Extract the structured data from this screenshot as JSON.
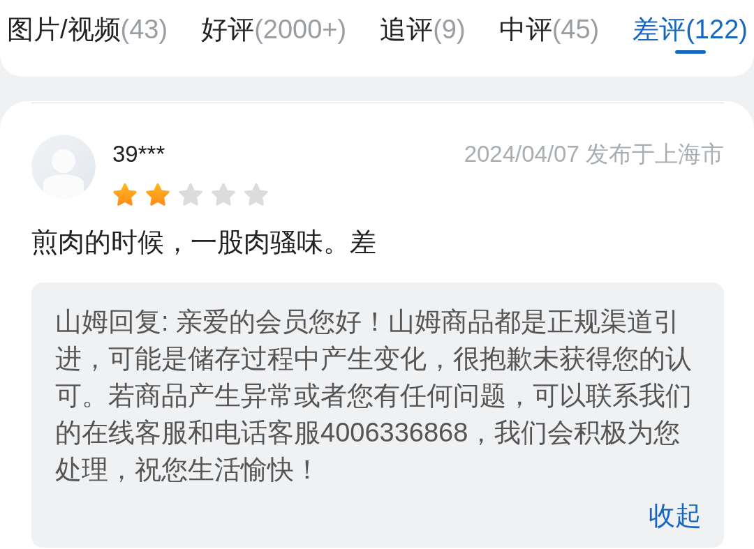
{
  "tabs": [
    {
      "label": "图片/视频",
      "count": "(43)",
      "selected": false
    },
    {
      "label": "好评",
      "count": "(2000+)",
      "selected": false
    },
    {
      "label": "追评",
      "count": "(9)",
      "selected": false
    },
    {
      "label": "中评",
      "count": "(45)",
      "selected": false
    },
    {
      "label": "差评",
      "count": "(122)",
      "selected": true
    }
  ],
  "review": {
    "username": "39***",
    "date": "2024/04/07 发布于上海市",
    "stars": 2,
    "text": "煎肉的时候，一股肉骚味。差",
    "reply": {
      "text": "山姆回复: 亲爱的会员您好！山姆商品都是正规渠道引进，可能是储存过程中产生变化，很抱歉未获得您的认可。若商品产生异常或者您有任何问题，可以联系我们的在线客服和电话客服4006336868，我们会积极为您处理，祝您生活愉快！",
      "collapse_link": "收起"
    }
  }
}
